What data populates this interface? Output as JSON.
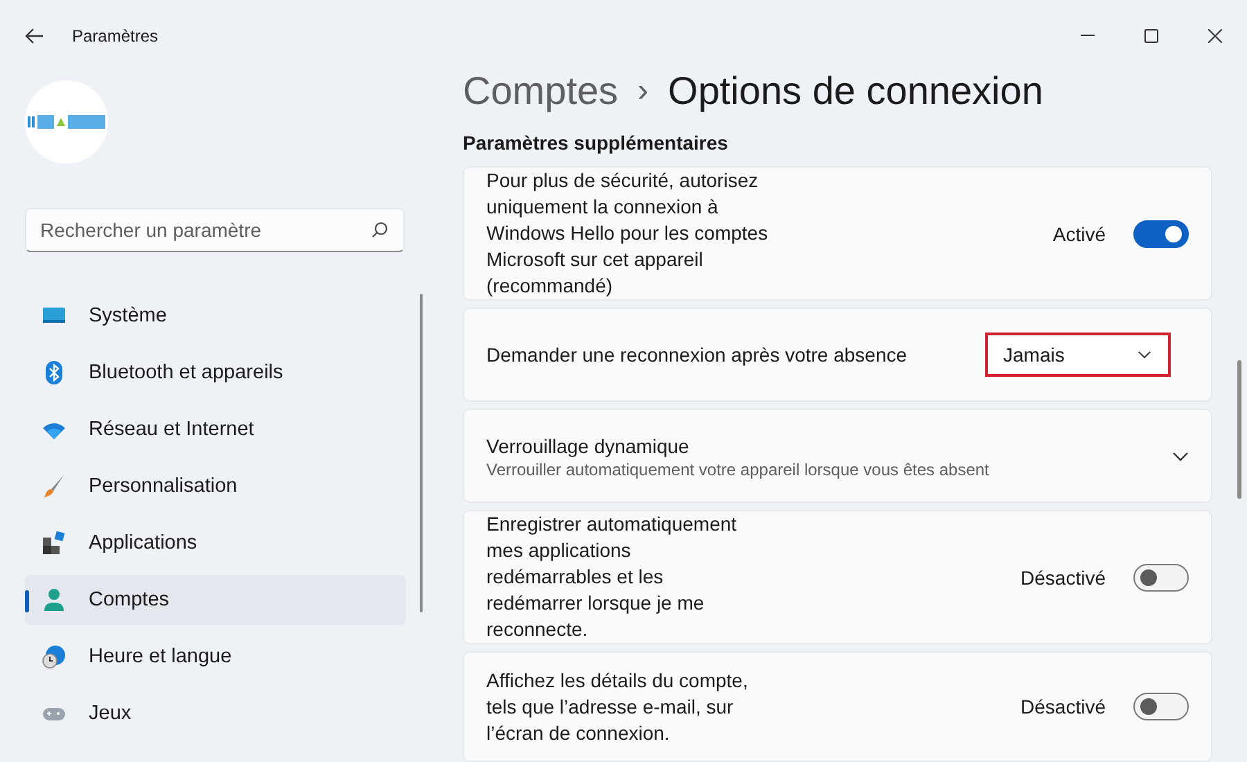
{
  "window": {
    "title": "Paramètres"
  },
  "search": {
    "placeholder": "Rechercher un paramètre"
  },
  "sidebar": {
    "items": [
      {
        "label": "Système",
        "selected": false
      },
      {
        "label": "Bluetooth et appareils",
        "selected": false
      },
      {
        "label": "Réseau et Internet",
        "selected": false
      },
      {
        "label": "Personnalisation",
        "selected": false
      },
      {
        "label": "Applications",
        "selected": false
      },
      {
        "label": "Comptes",
        "selected": true
      },
      {
        "label": "Heure et langue",
        "selected": false
      },
      {
        "label": "Jeux",
        "selected": false
      }
    ]
  },
  "breadcrumb": {
    "parent": "Comptes",
    "separator": "›",
    "current": "Options de connexion"
  },
  "section": {
    "title": "Paramètres supplémentaires"
  },
  "settings": [
    {
      "kind": "toggle",
      "label": "Pour plus de sécurité, autorisez uniquement la connexion à Windows Hello pour les comptes Microsoft sur cet appareil (recommandé)",
      "state_label": "Activé",
      "on": true
    },
    {
      "kind": "dropdown",
      "label": "Demander une reconnexion après votre absence",
      "value": "Jamais",
      "highlighted": true
    },
    {
      "kind": "expander",
      "label": "Verrouillage dynamique",
      "description": "Verrouiller automatiquement votre appareil lorsque vous êtes absent",
      "expanded": false
    },
    {
      "kind": "toggle",
      "label": "Enregistrer automatiquement mes applications redémarrables et les redémarrer lorsque je me reconnecte.",
      "state_label": "Désactivé",
      "on": false
    },
    {
      "kind": "toggle",
      "label": "Affichez les détails du compte, tels que l’adresse e-mail, sur l’écran de connexion.",
      "state_label": "Désactivé",
      "on": false
    }
  ]
}
